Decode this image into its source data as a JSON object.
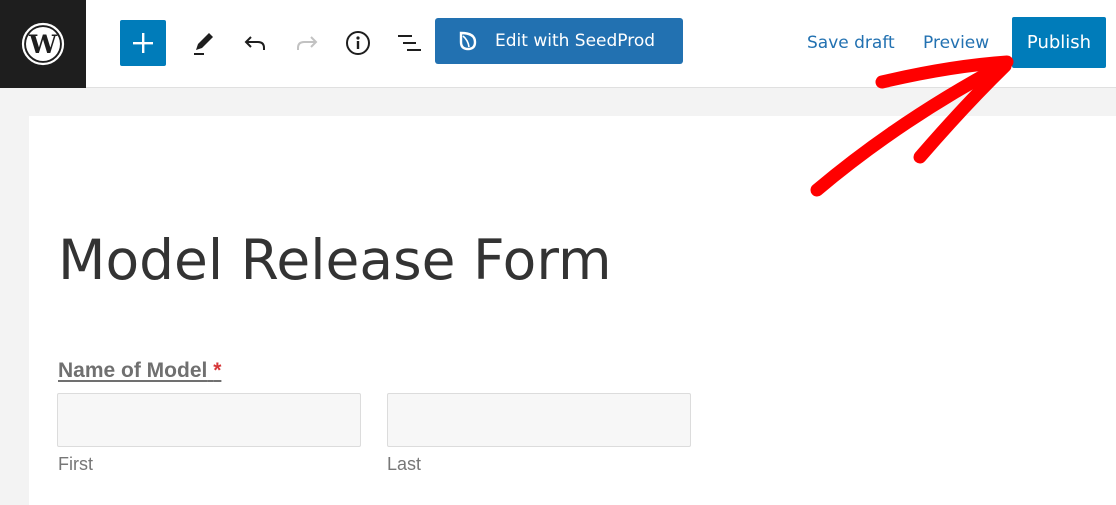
{
  "header": {
    "logo_icon": "wordpress-logo-icon",
    "add_block_icon": "plus-icon",
    "tools": [
      {
        "name": "edit-tool",
        "icon": "pencil-icon"
      },
      {
        "name": "undo",
        "icon": "undo-icon"
      },
      {
        "name": "redo",
        "icon": "redo-icon",
        "disabled": true
      },
      {
        "name": "details",
        "icon": "info-icon"
      },
      {
        "name": "list-view",
        "icon": "list-view-icon"
      }
    ],
    "seedprod_label": "Edit with SeedProd",
    "save_draft_label": "Save draft",
    "preview_label": "Preview",
    "publish_label": "Publish",
    "colors": {
      "accent": "#007cba",
      "seedprod": "#2271b1",
      "annotation_arrow": "#ff0000"
    }
  },
  "page": {
    "title": "Model Release Form",
    "form": {
      "field_label": "Name of Model",
      "required_marker": "*",
      "inputs": [
        {
          "sub_label": "First",
          "value": "",
          "placeholder": ""
        },
        {
          "sub_label": "Last",
          "value": "",
          "placeholder": ""
        }
      ]
    }
  },
  "annotation": {
    "type": "arrow",
    "points_to": "publish-button"
  }
}
